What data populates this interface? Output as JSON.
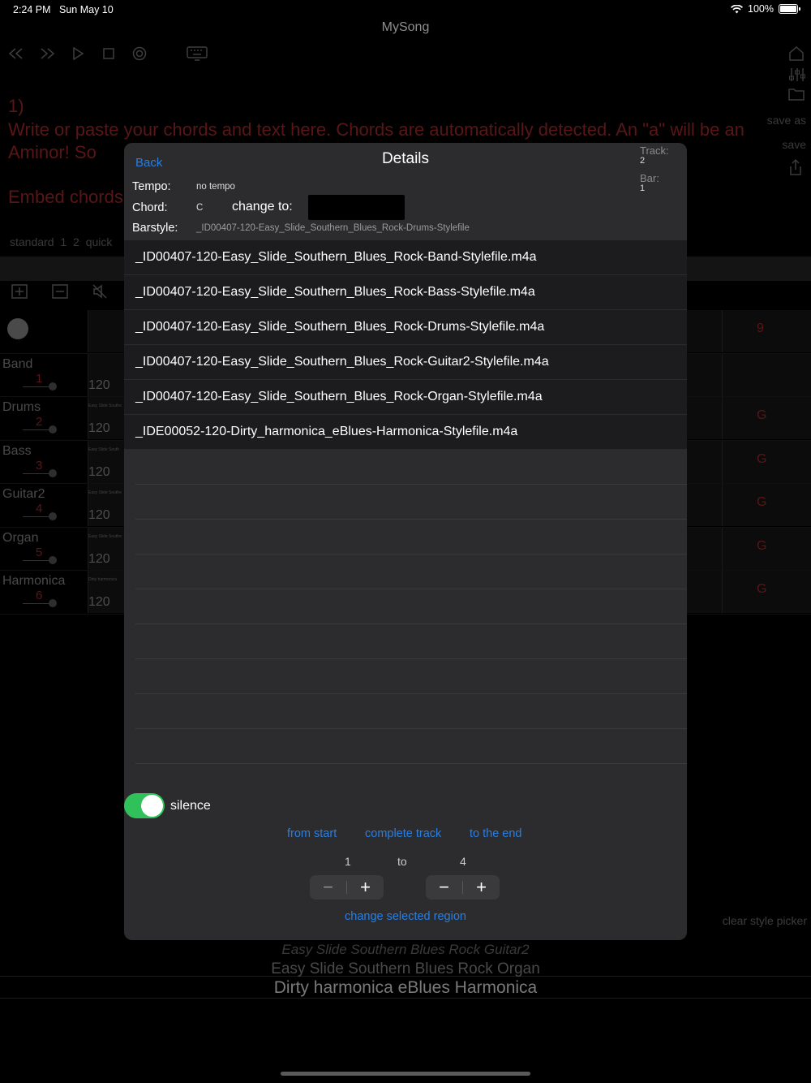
{
  "status": {
    "time": "2:24 PM",
    "date": "Sun May 10",
    "battery": "100%"
  },
  "app": {
    "title": "MySong"
  },
  "right_tools": {
    "save_as": "save as",
    "save": "save"
  },
  "background": {
    "line_number": "1)",
    "instructions": "Write or paste your chords and text here. Chords are automatically detected. An \"a\" will be an Aminor! So",
    "embed": "Embed chords",
    "tabs": "standard 1   2   quick",
    "tracks": [
      {
        "name": "Band",
        "num": "1",
        "bpm": "120",
        "tiny": "",
        "chord": ""
      },
      {
        "name": "Drums",
        "num": "2",
        "bpm": "120",
        "tiny": "Easy Slide Southe",
        "chord": "G"
      },
      {
        "name": "Bass",
        "num": "3",
        "bpm": "120",
        "tiny": "Easy Slide South",
        "chord": "G"
      },
      {
        "name": "Guitar2",
        "num": "4",
        "bpm": "120",
        "tiny": "Easy Slide Southe",
        "chord": "G"
      },
      {
        "name": "Organ",
        "num": "5",
        "bpm": "120",
        "tiny": "Easy Slide Southe",
        "chord": "G"
      },
      {
        "name": "Harmonica",
        "num": "6",
        "bpm": "120",
        "tiny": "Dirty harmonica",
        "chord": "G"
      }
    ],
    "top_chord": "9",
    "clear_style_picker": "clear style picker",
    "picker": [
      "Easy Slide Southern Blues Rock Guitar2",
      "Easy Slide Southern Blues Rock Organ",
      "Dirty harmonica eBlues Harmonica"
    ]
  },
  "modal": {
    "back": "Back",
    "title": "Details",
    "track_label": "Track:",
    "track_value": "2",
    "bar_label": "Bar:",
    "bar_value": "1",
    "tempo_label": "Tempo:",
    "tempo_value": "no tempo",
    "chord_label": "Chord:",
    "chord_value": "C",
    "change_to": "change to:",
    "barstyle_label": "Barstyle:",
    "barstyle_value": "_ID00407-120-Easy_Slide_Southern_Blues_Rock-Drums-Stylefile",
    "files": [
      "_ID00407-120-Easy_Slide_Southern_Blues_Rock-Band-Stylefile.m4a",
      "_ID00407-120-Easy_Slide_Southern_Blues_Rock-Bass-Stylefile.m4a",
      "_ID00407-120-Easy_Slide_Southern_Blues_Rock-Drums-Stylefile.m4a",
      "_ID00407-120-Easy_Slide_Southern_Blues_Rock-Guitar2-Stylefile.m4a",
      "_ID00407-120-Easy_Slide_Southern_Blues_Rock-Organ-Stylefile.m4a",
      "_IDE00052-120-Dirty_harmonica_eBlues-Harmonica-Stylefile.m4a"
    ],
    "silence": "silence",
    "from_start": "from start",
    "complete_track": "complete track",
    "to_the_end": "to the end",
    "range_from": "1",
    "range_to_label": "to",
    "range_to": "4",
    "change_region": "change selected region",
    "accent": "#2a7ee0",
    "toggle_color": "#30c15a"
  }
}
